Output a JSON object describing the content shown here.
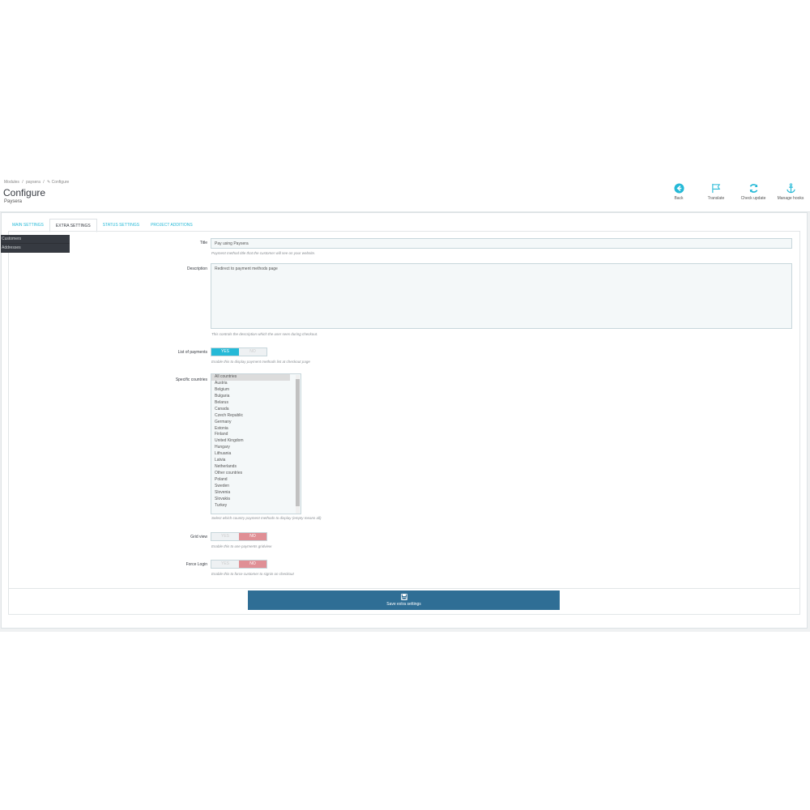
{
  "breadcrumb": {
    "item1": "Modules",
    "sep": "/",
    "item2": "paysera",
    "item3": "✎ Configure"
  },
  "header": {
    "title": "Configure",
    "subtitle": "Paysera"
  },
  "toolbar": {
    "back": "Back",
    "translate": "Translate",
    "check_update": "Check update",
    "manage_hooks": "Manage hooks",
    "accent_color": "#25b9d7"
  },
  "tabs": [
    "MAIN SETTINGS",
    "EXTRA SETTINGS",
    "STATUS SETTINGS",
    "PROJECT ADDITIONS"
  ],
  "active_tab": "EXTRA SETTINGS",
  "side_menu": [
    "Customers",
    "Addresses"
  ],
  "form": {
    "title": {
      "label": "Title",
      "value": "Pay using Paysera",
      "help": "Payment method title that the customer will see on your website."
    },
    "description": {
      "label": "Description",
      "value": "Redirect to payment methods page",
      "help": "This controls the description which the user sees during checkout."
    },
    "list_of_payments": {
      "label": "List of payments",
      "yes": "YES",
      "no": "NO",
      "value": "YES",
      "help": "Enable this to display payment methods list at checkout page"
    },
    "specific_countries": {
      "label": "Specific countries",
      "options": [
        "All countries",
        "Austria",
        "Belgium",
        "Bulgaria",
        "Belarus",
        "Canada",
        "Czech Republic",
        "Germany",
        "Estonia",
        "Finland",
        "United Kingdom",
        "Hungary",
        "Lithuania",
        "Latvia",
        "Netherlands",
        "Other countries",
        "Poland",
        "Sweden",
        "Slovenia",
        "Slovakia",
        "Turkey"
      ],
      "selected": "All countries",
      "help": "Select which country payment methods to display (empty means all)"
    },
    "grid_view": {
      "label": "Grid view",
      "yes": "YES",
      "no": "NO",
      "value": "NO",
      "help": "Enable this to use payments gridview"
    },
    "force_login": {
      "label": "Force Login",
      "yes": "YES",
      "no": "NO",
      "value": "NO",
      "help": "Enable this to force customer to signin on checkout"
    }
  },
  "save_button": {
    "label": "Save extra settings",
    "color": "#2f6e95"
  }
}
